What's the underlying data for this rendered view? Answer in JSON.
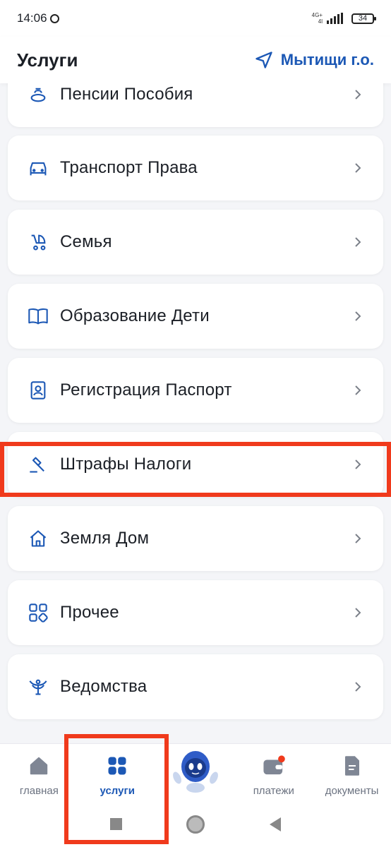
{
  "status_bar": {
    "time": "14:06",
    "network_top": "4G+",
    "network_bottom": "4l",
    "battery": "34"
  },
  "header": {
    "title": "Услуги",
    "location": "Мытищи г.о."
  },
  "services": [
    {
      "label": "Пенсии Пособия",
      "icon": "coins-icon"
    },
    {
      "label": "Транспорт Права",
      "icon": "car-icon"
    },
    {
      "label": "Семья",
      "icon": "stroller-icon"
    },
    {
      "label": "Образование Дети",
      "icon": "book-icon"
    },
    {
      "label": "Регистрация Паспорт",
      "icon": "passport-icon"
    },
    {
      "label": "Штрафы Налоги",
      "icon": "gavel-icon"
    },
    {
      "label": "Земля Дом",
      "icon": "house-icon"
    },
    {
      "label": "Прочее",
      "icon": "grid-icon"
    },
    {
      "label": "Ведомства",
      "icon": "emblem-icon"
    }
  ],
  "bottom_nav": [
    {
      "label": "главная",
      "icon": "home-icon",
      "active": false
    },
    {
      "label": "услуги",
      "icon": "services-grid-icon",
      "active": true
    },
    {
      "label": "",
      "icon": "robot-assistant-icon",
      "active": false
    },
    {
      "label": "платежи",
      "icon": "wallet-icon",
      "active": false
    },
    {
      "label": "документы",
      "icon": "document-icon",
      "active": false
    }
  ],
  "colors": {
    "accent": "#1c58b5",
    "highlight": "#f03a1c",
    "background": "#f4f5f8"
  }
}
